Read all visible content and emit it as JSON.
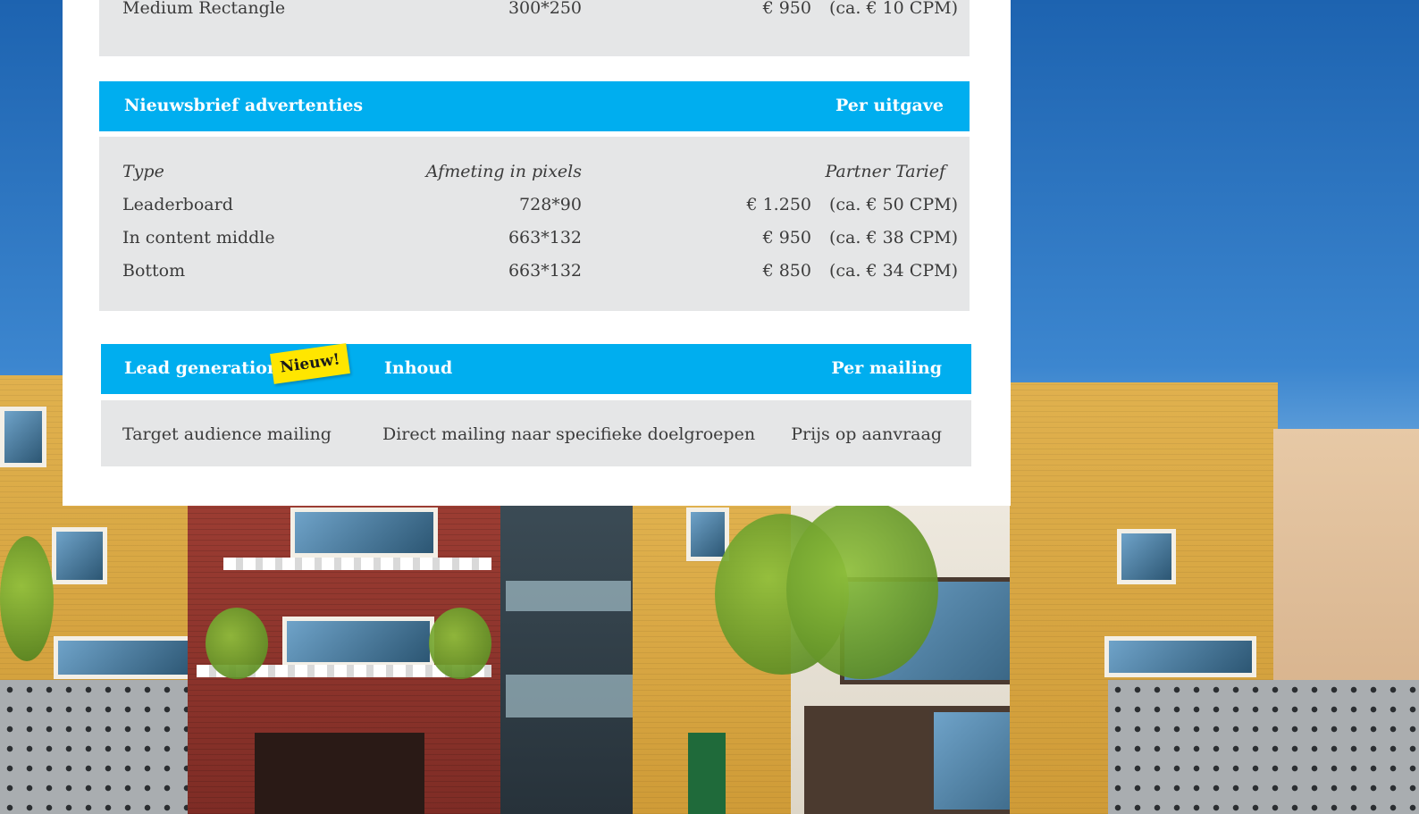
{
  "display_ads": {
    "rows": [
      {
        "type": "Medium Rectangle",
        "size": "300*250",
        "price": "€ 950",
        "cpm": "(ca. € 10 CPM)"
      }
    ]
  },
  "newsletter": {
    "title": "Nieuwsbrief advertenties",
    "period": "Per uitgave",
    "columns": {
      "type": "Type",
      "size": "Afmeting in pixels",
      "rate": "Partner Tarief"
    },
    "rows": [
      {
        "type": "Leaderboard",
        "size": "728*90",
        "price": "€ 1.250",
        "cpm": "(ca. € 50 CPM)"
      },
      {
        "type": "In content middle",
        "size": "663*132",
        "price": "€ 950",
        "cpm": "(ca. € 38 CPM)"
      },
      {
        "type": "Bottom",
        "size": "663*132",
        "price": "€ 850",
        "cpm": "(ca. € 34 CPM)"
      }
    ]
  },
  "lead_generation": {
    "title": "Lead generation",
    "badge": "Nieuw!",
    "content_header": "Inhoud",
    "period": "Per mailing",
    "row": {
      "type": "Target audience mailing",
      "content": "Direct mailing naar specifieke doelgroepen",
      "price": "Prijs op aanvraag"
    }
  },
  "colors": {
    "accent": "#00aeef",
    "table_bg": "#e5e6e7",
    "badge": "#ffe600",
    "text": "#3b3b3b"
  }
}
